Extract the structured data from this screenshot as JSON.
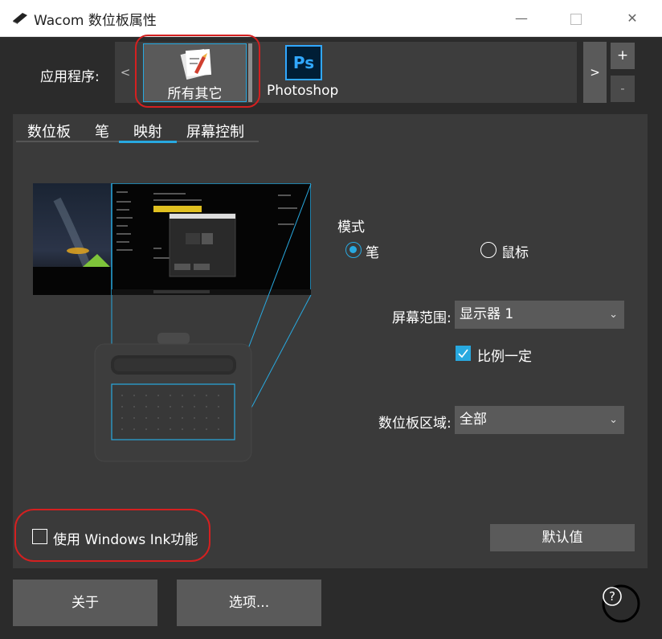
{
  "window": {
    "title": "Wacom 数位板属性",
    "min_glyph": "—",
    "close_glyph": "✕"
  },
  "applications": {
    "label": "应用程序:",
    "prev": "<",
    "next": ">",
    "add": "+",
    "remove": "-",
    "items": [
      {
        "label": "所有其它",
        "icon": "all-other-apps-icon",
        "selected": true
      },
      {
        "label": "Photoshop",
        "icon": "photoshop-icon",
        "icon_text": "Ps",
        "selected": false
      }
    ]
  },
  "tabs": [
    {
      "label": "数位板",
      "active": false
    },
    {
      "label": "笔",
      "active": false
    },
    {
      "label": "映射",
      "active": true
    },
    {
      "label": "屏幕控制",
      "active": false
    }
  ],
  "mapping": {
    "mode_label": "模式",
    "mode_options": [
      {
        "label": "笔",
        "selected": true
      },
      {
        "label": "鼠标",
        "selected": false
      }
    ],
    "screen_area_label": "屏幕范围:",
    "screen_area_value": "显示器 1",
    "proportional_label": "比例一定",
    "proportional_checked": true,
    "tablet_area_label": "数位板区域:",
    "tablet_area_value": "全部",
    "windows_ink_label": "使用 Windows Ink功能",
    "windows_ink_checked": false,
    "default_button": "默认值"
  },
  "footer": {
    "about_button": "关于",
    "options_button": "选项...",
    "help_glyph": "?"
  },
  "colors": {
    "background": "#2b2b2b",
    "panel": "#3a3a3a",
    "button": "#5a5a5a",
    "accent": "#28a9e0",
    "annotation": "#d42020"
  }
}
